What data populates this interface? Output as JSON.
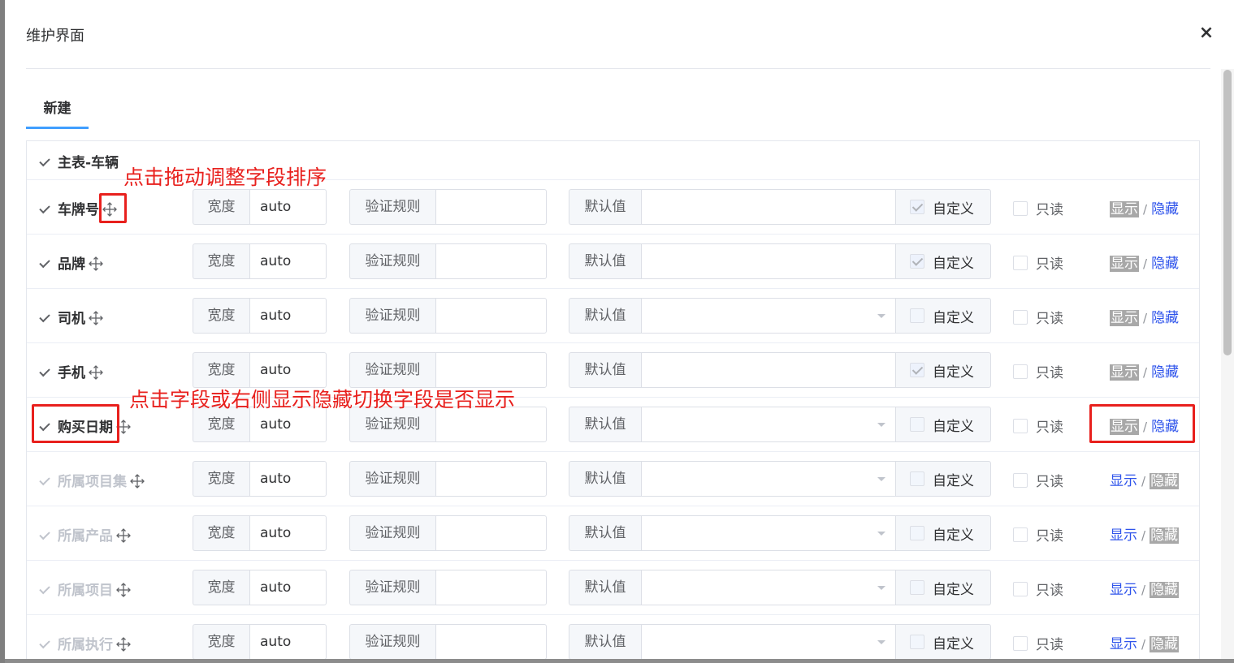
{
  "modal": {
    "title": "维护界面",
    "close": "×"
  },
  "tabs": [
    {
      "label": "新建"
    }
  ],
  "group": {
    "label": "主表-车辆"
  },
  "labels": {
    "width": "宽度",
    "rule": "验证规则",
    "default": "默认值",
    "custom": "自定义",
    "readonly": "只读",
    "show": "显示",
    "sep": "/",
    "hide": "隐藏"
  },
  "rows": [
    {
      "name": "车牌号",
      "width": "auto",
      "default_select": false,
      "custom_checked": true,
      "visible": true
    },
    {
      "name": "品牌",
      "width": "auto",
      "default_select": false,
      "custom_checked": true,
      "visible": true
    },
    {
      "name": "司机",
      "width": "auto",
      "default_select": true,
      "custom_checked": false,
      "visible": true
    },
    {
      "name": "手机",
      "width": "auto",
      "default_select": false,
      "custom_checked": true,
      "visible": true
    },
    {
      "name": "购买日期",
      "width": "auto",
      "default_select": true,
      "custom_checked": false,
      "visible": true
    },
    {
      "name": "所属项目集",
      "width": "auto",
      "default_select": true,
      "custom_checked": false,
      "visible": false
    },
    {
      "name": "所属产品",
      "width": "auto",
      "default_select": true,
      "custom_checked": false,
      "visible": false
    },
    {
      "name": "所属项目",
      "width": "auto",
      "default_select": true,
      "custom_checked": false,
      "visible": false
    },
    {
      "name": "所属执行",
      "width": "auto",
      "default_select": true,
      "custom_checked": false,
      "visible": false
    }
  ],
  "annotations": {
    "drag_hint": "点击拖动调整字段排序",
    "toggle_hint": "点击字段或右侧显示隐藏切换字段是否显示"
  },
  "colors": {
    "accent": "#409eff",
    "link": "#2f54eb",
    "annotation": "#e8201d"
  },
  "icons": {
    "drag": "drag-move-icon",
    "close": "close-icon",
    "check": "check-icon"
  }
}
